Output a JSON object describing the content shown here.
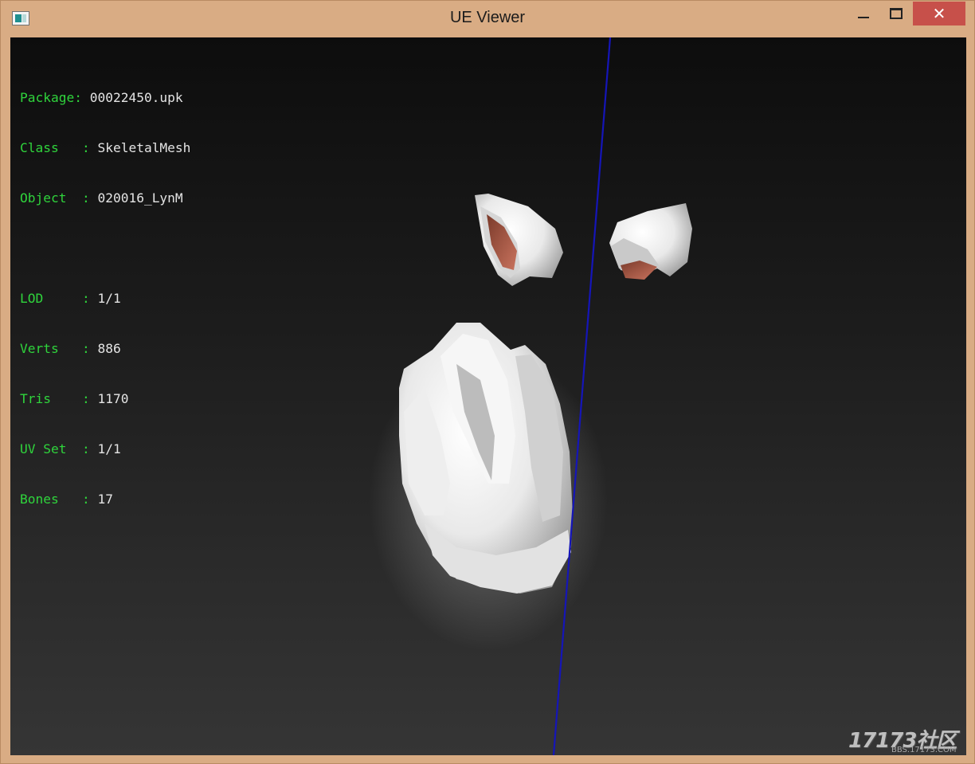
{
  "window": {
    "title": "UE Viewer",
    "close_glyph": "✕"
  },
  "info": {
    "rows": [
      {
        "key": "Package:",
        "value": "00022450.upk"
      },
      {
        "key": "Class   :",
        "value": "SkeletalMesh"
      },
      {
        "key": "Object  :",
        "value": "020016_LynM"
      },
      {
        "key": "LOD     :",
        "value": "1/1"
      },
      {
        "key": "Verts   :",
        "value": "886"
      },
      {
        "key": "Tris    :",
        "value": "1170"
      },
      {
        "key": "UV Set  :",
        "value": "1/1"
      },
      {
        "key": "Bones   :",
        "value": "17"
      }
    ]
  },
  "watermark": {
    "brand": "17173社区",
    "url": "BBS.17173.COM"
  },
  "colors": {
    "label_green": "#2fd43c",
    "axis_blue": "#1515b8",
    "close_red": "#c7504a"
  }
}
